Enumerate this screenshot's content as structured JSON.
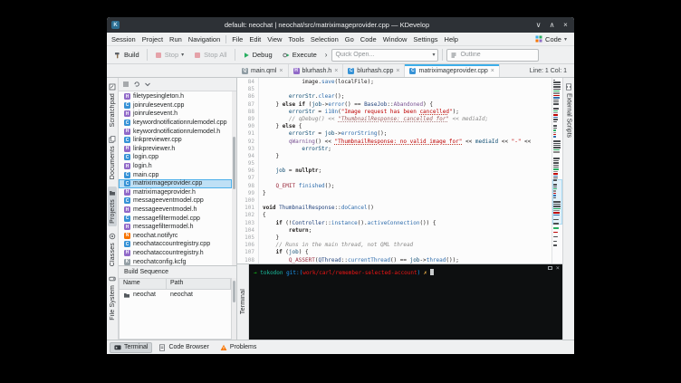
{
  "window": {
    "title": "default: neochat | neochat/src/matriximageprovider.cpp — KDevelop",
    "controls": {
      "minimize": "∨",
      "maximize": "∧",
      "close": "×"
    }
  },
  "icons": {
    "chevron_down": "▾",
    "expander": "›",
    "close": "×"
  },
  "menubar": {
    "session_menus": [
      "Session",
      "Project",
      "Run",
      "Navigation"
    ],
    "main_menus": [
      "File",
      "Edit",
      "View",
      "Tools",
      "Selection",
      "Go",
      "Code",
      "Window",
      "Settings",
      "Help"
    ],
    "area_switcher": {
      "label": "Code",
      "chevron": "▾"
    }
  },
  "toolbar": {
    "build": "Build",
    "stop": "Stop",
    "stop_all": "Stop All",
    "debug": "Debug",
    "execute": "Execute",
    "quick_open_placeholder": "Quick Open...",
    "outline_placeholder": "Outline"
  },
  "tabbar": {
    "tabs": [
      {
        "label": "main.qml",
        "icon": "qml",
        "active": false
      },
      {
        "label": "blurhash.h",
        "icon": "h",
        "active": false
      },
      {
        "label": "blurhash.cpp",
        "icon": "cpp",
        "active": false
      },
      {
        "label": "matriximageprovider.cpp",
        "icon": "cpp",
        "active": true
      }
    ],
    "close_glyph": "×",
    "cursor_status": "Line: 1 Col: 1"
  },
  "left_dock": [
    {
      "label": "Scratchpad",
      "icon": "scratchpad",
      "active": false
    },
    {
      "label": "Documents",
      "icon": "documents",
      "active": false
    },
    {
      "label": "Projects",
      "icon": "folder",
      "active": true
    },
    {
      "label": "Classes",
      "icon": "classes",
      "active": false
    },
    {
      "label": "File System",
      "icon": "drive",
      "active": false
    }
  ],
  "right_dock": [
    {
      "label": "External Scripts",
      "icon": "script",
      "active": false
    }
  ],
  "projects_panel": {
    "files": [
      {
        "name": "filetypesingleton.h",
        "type": "h"
      },
      {
        "name": "joinrulesevent.cpp",
        "type": "cpp"
      },
      {
        "name": "joinrulesevent.h",
        "type": "h"
      },
      {
        "name": "keywordnotificationrulemodel.cpp",
        "type": "cpp"
      },
      {
        "name": "keywordnotificationrulemodel.h",
        "type": "h"
      },
      {
        "name": "linkpreviewer.cpp",
        "type": "cpp"
      },
      {
        "name": "linkpreviewer.h",
        "type": "h"
      },
      {
        "name": "login.cpp",
        "type": "cpp"
      },
      {
        "name": "login.h",
        "type": "h"
      },
      {
        "name": "main.cpp",
        "type": "cpp"
      },
      {
        "name": "matriximageprovider.cpp",
        "type": "cpp",
        "selected": true
      },
      {
        "name": "matriximageprovider.h",
        "type": "h"
      },
      {
        "name": "messageeventmodel.cpp",
        "type": "cpp"
      },
      {
        "name": "messageeventmodel.h",
        "type": "h"
      },
      {
        "name": "messagefiltermodel.cpp",
        "type": "cpp"
      },
      {
        "name": "messagefiltermodel.h",
        "type": "h"
      },
      {
        "name": "neochat.notifyrc",
        "type": "rc"
      },
      {
        "name": "neochataccountregistry.cpp",
        "type": "cpp"
      },
      {
        "name": "neochataccountregistry.h",
        "type": "h"
      },
      {
        "name": "neochatconfig.kcfg",
        "type": "kcfg"
      }
    ]
  },
  "build_sequence": {
    "title": "Build Sequence",
    "columns": [
      "Name",
      "Path"
    ],
    "rows": [
      {
        "name": "neochat",
        "path": "neochat"
      }
    ]
  },
  "editor": {
    "lines": [
      {
        "n": 84,
        "segs": [
          [
            "            image.",
            "d"
          ],
          [
            "save",
            "f"
          ],
          [
            "(localFile);",
            "d"
          ]
        ]
      },
      {
        "n": 85,
        "segs": []
      },
      {
        "n": 86,
        "segs": [
          [
            "        ",
            "d"
          ],
          [
            "errorStr",
            "v"
          ],
          [
            ".",
            "d"
          ],
          [
            "clear",
            "f"
          ],
          [
            "();",
            "d"
          ]
        ]
      },
      {
        "n": 87,
        "segs": [
          [
            "    } ",
            "d"
          ],
          [
            "else",
            "k"
          ],
          [
            " ",
            "d"
          ],
          [
            "if",
            "k"
          ],
          [
            " (",
            "d"
          ],
          [
            "job",
            "v"
          ],
          [
            "->",
            "d"
          ],
          [
            "error",
            "f"
          ],
          [
            "() == ",
            "d"
          ],
          [
            "BaseJob",
            "t"
          ],
          [
            "::",
            "d"
          ],
          [
            "Abandoned",
            "e"
          ],
          [
            ") {",
            "d"
          ]
        ]
      },
      {
        "n": 88,
        "segs": [
          [
            "        ",
            "d"
          ],
          [
            "errorStr",
            "v"
          ],
          [
            " = ",
            "d"
          ],
          [
            "i18n",
            "f"
          ],
          [
            "(",
            "d"
          ],
          [
            "\"Image request has been ",
            "s"
          ],
          [
            "cancelled",
            "su"
          ],
          [
            "\"",
            "s"
          ],
          [
            ");",
            "d"
          ]
        ]
      },
      {
        "n": 89,
        "segs": [
          [
            "        ",
            "d"
          ],
          [
            "// qDebug() << ",
            "c"
          ],
          [
            "\"ThumbnailResponse: cancelled for\"",
            "cs"
          ],
          [
            " << mediaId;",
            "c"
          ]
        ]
      },
      {
        "n": 90,
        "segs": [
          [
            "    } ",
            "d"
          ],
          [
            "else",
            "k"
          ],
          [
            " {",
            "d"
          ]
        ]
      },
      {
        "n": 91,
        "segs": [
          [
            "        ",
            "d"
          ],
          [
            "errorStr",
            "v"
          ],
          [
            " = ",
            "d"
          ],
          [
            "job",
            "v"
          ],
          [
            "->",
            "d"
          ],
          [
            "errorString",
            "f"
          ],
          [
            "();",
            "d"
          ]
        ]
      },
      {
        "n": 92,
        "segs": [
          [
            "        ",
            "d"
          ],
          [
            "qWarning",
            "e"
          ],
          [
            "() << ",
            "d"
          ],
          [
            "\"ThumbnailResponse: no valid image for\"",
            "su"
          ],
          [
            " << ",
            "d"
          ],
          [
            "mediaId",
            "v"
          ],
          [
            " << ",
            "d"
          ],
          [
            "\"-\"",
            "s"
          ],
          [
            " <<",
            "d"
          ]
        ]
      },
      {
        "n": 93,
        "segs": [
          [
            "            ",
            "d"
          ],
          [
            "errorStr",
            "v"
          ],
          [
            ";",
            "d"
          ]
        ]
      },
      {
        "n": 94,
        "segs": [
          [
            "    }",
            "d"
          ]
        ]
      },
      {
        "n": 95,
        "segs": []
      },
      {
        "n": 96,
        "segs": [
          [
            "    ",
            "d"
          ],
          [
            "job",
            "v"
          ],
          [
            " = ",
            "d"
          ],
          [
            "nullptr",
            "k"
          ],
          [
            ";",
            "d"
          ]
        ]
      },
      {
        "n": 97,
        "segs": []
      },
      {
        "n": 98,
        "segs": [
          [
            "    ",
            "d"
          ],
          [
            "Q_EMIT",
            "m"
          ],
          [
            " ",
            "d"
          ],
          [
            "finished",
            "f"
          ],
          [
            "();",
            "d"
          ]
        ]
      },
      {
        "n": 99,
        "segs": [
          [
            "}",
            "d"
          ]
        ]
      },
      {
        "n": 100,
        "segs": []
      },
      {
        "n": 101,
        "segs": [
          [
            "void",
            "k"
          ],
          [
            " ",
            "d"
          ],
          [
            "ThumbnailResponse",
            "t"
          ],
          [
            "::",
            "d"
          ],
          [
            "doCancel",
            "f"
          ],
          [
            "()",
            "d"
          ]
        ]
      },
      {
        "n": 102,
        "segs": [
          [
            "{",
            "d"
          ]
        ]
      },
      {
        "n": 103,
        "segs": [
          [
            "    ",
            "d"
          ],
          [
            "if",
            "k"
          ],
          [
            " (!",
            "d"
          ],
          [
            "Controller",
            "t"
          ],
          [
            "::",
            "d"
          ],
          [
            "instance",
            "f"
          ],
          [
            "().",
            "d"
          ],
          [
            "activeConnection",
            "f"
          ],
          [
            "()) {",
            "d"
          ]
        ]
      },
      {
        "n": 104,
        "segs": [
          [
            "        ",
            "d"
          ],
          [
            "return",
            "k"
          ],
          [
            ";",
            "d"
          ]
        ]
      },
      {
        "n": 105,
        "segs": [
          [
            "    }",
            "d"
          ]
        ]
      },
      {
        "n": 106,
        "segs": [
          [
            "    ",
            "d"
          ],
          [
            "// Runs in the main thread, not QML thread",
            "c"
          ]
        ]
      },
      {
        "n": 107,
        "segs": [
          [
            "    ",
            "d"
          ],
          [
            "if",
            "k"
          ],
          [
            " (",
            "d"
          ],
          [
            "job",
            "v"
          ],
          [
            ") {",
            "d"
          ]
        ]
      },
      {
        "n": 108,
        "segs": [
          [
            "        ",
            "d"
          ],
          [
            "Q_ASSERT",
            "m"
          ],
          [
            "(",
            "d"
          ],
          [
            "QThread",
            "t"
          ],
          [
            "::",
            "d"
          ],
          [
            "currentThread",
            "f"
          ],
          [
            "() == ",
            "d"
          ],
          [
            "job",
            "v"
          ],
          [
            "->",
            "d"
          ],
          [
            "thread",
            "f"
          ],
          [
            "());",
            "d"
          ]
        ]
      }
    ]
  },
  "terminal": {
    "label": "Terminal",
    "prompt": [
      [
        "→ ",
        "green"
      ],
      [
        "tokodon ",
        "cyan"
      ],
      [
        "git:(",
        "blue"
      ],
      [
        "work/carl/remember-selected-account",
        "red"
      ],
      [
        ") ",
        "blue"
      ],
      [
        "✗ ",
        "yellow"
      ]
    ]
  },
  "statusbar": [
    {
      "label": "Terminal",
      "icon": "terminal",
      "active": true
    },
    {
      "label": "Code Browser",
      "icon": "codebrowser",
      "active": false
    },
    {
      "label": "Problems",
      "icon": "problems",
      "active": false
    }
  ]
}
